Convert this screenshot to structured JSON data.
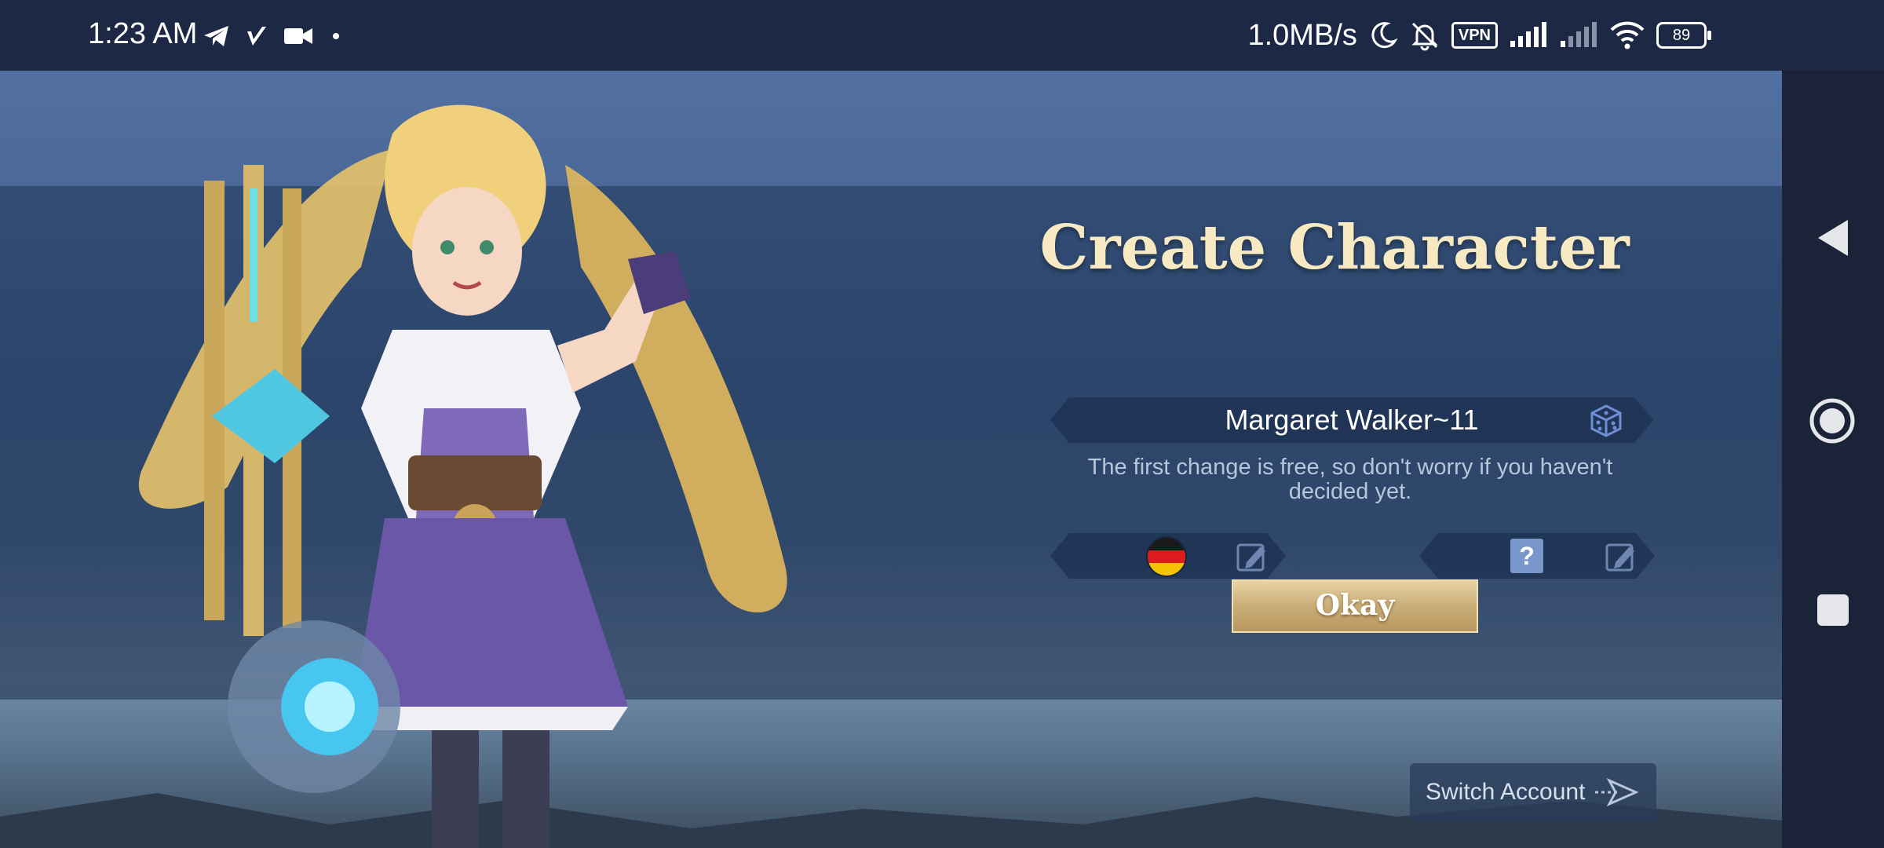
{
  "status_bar": {
    "time": "1:23 AM",
    "left_icons": [
      "telegram-icon",
      "check-feather-icon",
      "video-camera-icon",
      "dot-icon"
    ],
    "net_speed": "1.0MB/s",
    "vpn_label": "VPN",
    "battery_level": "89",
    "right_icons": [
      "moon-icon",
      "bell-muted-icon",
      "vpn-icon",
      "signal-icon",
      "signal-weak-icon",
      "wifi-icon",
      "battery-icon"
    ]
  },
  "dialog": {
    "title": "Create Character",
    "name_value": "Margaret Walker~11",
    "hint": "The first change is free, so don't worry if you haven't decided yet.",
    "region_flag": "germany-flag",
    "unknown_mark": "?",
    "okay_label": "Okay"
  },
  "footer": {
    "switch_account_label": "Switch Account"
  },
  "colors": {
    "title": "#f7e9c2",
    "okay_button": "#c9ad77",
    "background": "#34507a"
  },
  "nav_bar": {
    "icons": [
      "back-icon",
      "home-icon",
      "recents-icon"
    ]
  }
}
